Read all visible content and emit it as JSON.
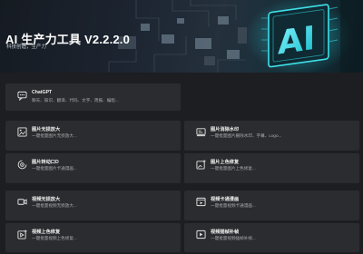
{
  "header": {
    "title": "AI 生产力工具 V2.2.2.0",
    "subtitle": "科技创造，生产力"
  },
  "cards": [
    {
      "title": "ChatGPT",
      "desc": "聊天、知识、翻译、代码、文字、周报、编程...",
      "icon": "chat-bubble-icon"
    },
    {
      "title": "图片无损放大",
      "desc": "一键批量图片无损放大...",
      "icon": "image-enlarge-icon"
    },
    {
      "title": "图片消除水印",
      "desc": "一键批量图片删除水印、字幕、Logo...",
      "icon": "image-eraser-icon"
    },
    {
      "title": "图片转动口D",
      "desc": "一键批量图片卡通漫画...",
      "icon": "image-cartoon-icon"
    },
    {
      "title": "图片上色修复",
      "desc": "一键批量图片上色修复...",
      "icon": "image-colorize-icon"
    },
    {
      "title": "视频无损放大",
      "desc": "一键批量视频无损放大...",
      "icon": "video-enlarge-icon"
    },
    {
      "title": "视频卡通漫画",
      "desc": "一键批量视频卡通漫画...",
      "icon": "video-cartoon-icon"
    },
    {
      "title": "视频上色修复",
      "desc": "一键批量视频上色修复...",
      "icon": "video-colorize-icon"
    },
    {
      "title": "视频插帧补帧",
      "desc": "一键批量视频插帧补帧...",
      "icon": "video-frame-icon"
    }
  ],
  "colors": {
    "background": "#1d1e21",
    "card": "#2b2c2f",
    "accent": "#3fe0e8",
    "text": "#f0f0f0",
    "muted": "#a9abae"
  }
}
